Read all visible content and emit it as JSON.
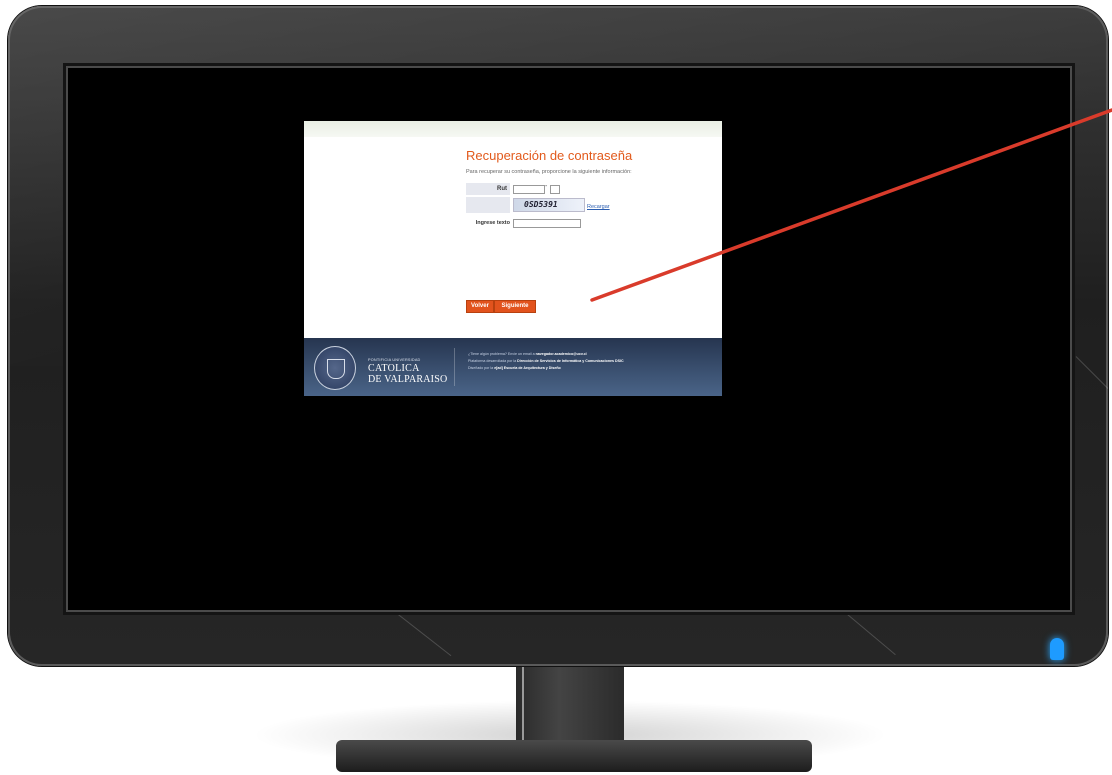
{
  "webpage": {
    "title": "Recuperación de contraseña",
    "instructions": "Para recuperar su contraseña, proporcione la siguiente información:",
    "rut_label": "Rut",
    "rut_dash": "-",
    "captcha_text": "0SD5391",
    "captcha_reload": "Recargar",
    "text_label": "Ingrese texto",
    "buttons": {
      "back": "Volver",
      "next": "Siguiente"
    },
    "footer": {
      "university_line1": "PONTIFICIA UNIVERSIDAD",
      "university_line2": "CATOLICA",
      "university_line3": "DE VALPARAISO",
      "help_prefix": "¿Tiene algún problema? Envíe un email a",
      "help_email": "navegador.academico@ucv.cl",
      "developed_prefix": "Plataforma desarrollada por la",
      "developed_by": "Dirección de Servicios de Informática y Comunicaciones DSIC",
      "designed_prefix": "Diseñado por la",
      "designed_by": "e[ad] Escuela de Arquitectura y Diseño"
    }
  },
  "colors": {
    "accent": "#e2531d",
    "annotation_arrow": "#d93b2b",
    "power_led": "#1e9bff",
    "footer_blue": "#3c5272"
  },
  "icons": [
    "university-seal-icon",
    "power-led-icon"
  ]
}
